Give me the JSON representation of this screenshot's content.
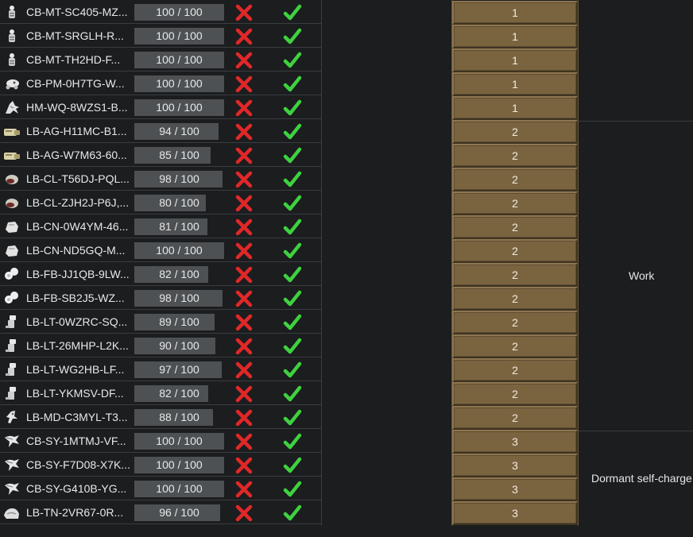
{
  "colors": {
    "background": "#1b1d1f",
    "bar_fill": "#4d5154",
    "priority_button": "#7a6440",
    "x_mark": "#e02828",
    "check_mark": "#3fd13f"
  },
  "bar_max": 100,
  "rows": [
    {
      "name": "CB-MT-SC405-MZ...",
      "bar": "100 / 100",
      "value": 100,
      "icon": "mech-termite-icon",
      "priority": "1"
    },
    {
      "name": "CB-MT-SRGLH-R...",
      "bar": "100 / 100",
      "value": 100,
      "icon": "mech-termite-icon",
      "priority": "1"
    },
    {
      "name": "CB-MT-TH2HD-F...",
      "bar": "100 / 100",
      "value": 100,
      "icon": "mech-termite-icon",
      "priority": "1"
    },
    {
      "name": "CB-PM-0H7TG-W...",
      "bar": "100 / 100",
      "value": 100,
      "icon": "mech-paramite-icon",
      "priority": "1"
    },
    {
      "name": "HM-WQ-8WZS1-B...",
      "bar": "100 / 100",
      "value": 100,
      "icon": "mech-warqueen-icon",
      "priority": "1"
    },
    {
      "name": "LB-AG-H11MC-B1...",
      "bar": "94 / 100",
      "value": 94,
      "icon": "mech-agrihand-icon",
      "priority": "2"
    },
    {
      "name": "LB-AG-W7M63-60...",
      "bar": "85 / 100",
      "value": 85,
      "icon": "mech-agrihand-icon",
      "priority": "2"
    },
    {
      "name": "LB-CL-T56DJ-PQL...",
      "bar": "98 / 100",
      "value": 98,
      "icon": "mech-cleansweeper-icon",
      "priority": "2"
    },
    {
      "name": "LB-CL-ZJH2J-P6J,...",
      "bar": "80 / 100",
      "value": 80,
      "icon": "mech-cleansweeper-icon",
      "priority": "2"
    },
    {
      "name": "LB-CN-0W4YM-46...",
      "bar": "81 / 100",
      "value": 81,
      "icon": "mech-constructoid-icon",
      "priority": "2"
    },
    {
      "name": "LB-CN-ND5GQ-M...",
      "bar": "100 / 100",
      "value": 100,
      "icon": "mech-constructoid-icon",
      "priority": "2"
    },
    {
      "name": "LB-FB-JJ1QB-9LW...",
      "bar": "82 / 100",
      "value": 82,
      "icon": "mech-fabricor-icon",
      "priority": "2"
    },
    {
      "name": "LB-FB-SB2J5-WZ...",
      "bar": "98 / 100",
      "value": 98,
      "icon": "mech-fabricor-icon",
      "priority": "2"
    },
    {
      "name": "LB-LT-0WZRC-SQ...",
      "bar": "89 / 100",
      "value": 89,
      "icon": "mech-lifter-icon",
      "priority": "2"
    },
    {
      "name": "LB-LT-26MHP-L2K...",
      "bar": "90 / 100",
      "value": 90,
      "icon": "mech-lifter-icon",
      "priority": "2"
    },
    {
      "name": "LB-LT-WG2HB-LF...",
      "bar": "97 / 100",
      "value": 97,
      "icon": "mech-lifter-icon",
      "priority": "2"
    },
    {
      "name": "LB-LT-YKMSV-DF...",
      "bar": "82 / 100",
      "value": 82,
      "icon": "mech-lifter-icon",
      "priority": "2"
    },
    {
      "name": "LB-MD-C3MYL-T3...",
      "bar": "88 / 100",
      "value": 88,
      "icon": "mech-militor-icon",
      "priority": "2"
    },
    {
      "name": "CB-SY-1MTMJ-VF...",
      "bar": "100 / 100",
      "value": 100,
      "icon": "mech-scyther-icon",
      "priority": "3"
    },
    {
      "name": "CB-SY-F7D08-X7K...",
      "bar": "100 / 100",
      "value": 100,
      "icon": "mech-scyther-icon",
      "priority": "3"
    },
    {
      "name": "CB-SY-G410B-YG...",
      "bar": "100 / 100",
      "value": 100,
      "icon": "mech-scyther-icon",
      "priority": "3"
    },
    {
      "name": "LB-TN-2VR67-0R...",
      "bar": "96 / 100",
      "value": 96,
      "icon": "mech-tunneler-icon",
      "priority": "3"
    }
  ],
  "groups": [
    {
      "label": "Work"
    },
    {
      "label": "Dormant self-charge"
    }
  ]
}
